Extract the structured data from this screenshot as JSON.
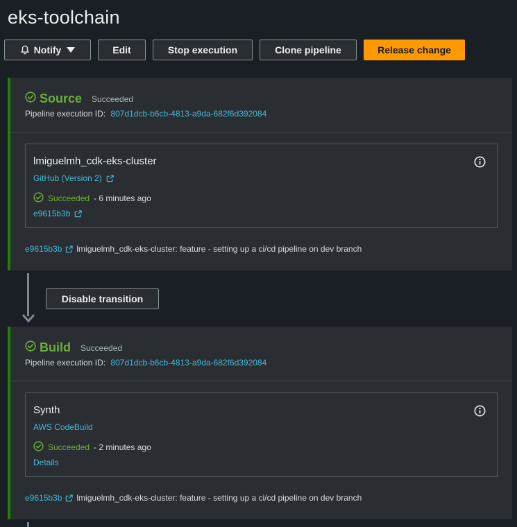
{
  "header": {
    "title": "eks-toolchain"
  },
  "toolbar": {
    "notify_label": "Notify",
    "edit_label": "Edit",
    "stop_label": "Stop execution",
    "clone_label": "Clone pipeline",
    "release_label": "Release change"
  },
  "colors": {
    "accent": "#ff9900",
    "success": "#6aaf35",
    "link": "#44b9d6",
    "stage_border": "#1d8102"
  },
  "stages": [
    {
      "name": "Source",
      "status": "Succeeded",
      "exec_label": "Pipeline execution ID:",
      "exec_id": "807d1dcb-b6cb-4813-a9da-682f6d392084",
      "action": {
        "name": "lmiguelmh_cdk-eks-cluster",
        "provider": "GitHub (Version 2)",
        "status": "Succeeded",
        "time": "- 6 minutes ago",
        "sub_link": "e9615b3b"
      },
      "revision": {
        "id": "e9615b3b",
        "message": "lmiguelmh_cdk-eks-cluster: feature - setting up a ci/cd pipeline on dev branch"
      }
    },
    {
      "name": "Build",
      "status": "Succeeded",
      "exec_label": "Pipeline execution ID:",
      "exec_id": "807d1dcb-b6cb-4813-a9da-682f6d392084",
      "action": {
        "name": "Synth",
        "provider": "AWS CodeBuild",
        "status": "Succeeded",
        "time": "- 2 minutes ago",
        "sub_link": "Details"
      },
      "revision": {
        "id": "e9615b3b",
        "message": "lmiguelmh_cdk-eks-cluster: feature - setting up a ci/cd pipeline on dev branch"
      }
    }
  ],
  "transition": {
    "button_label": "Disable transition"
  },
  "icons": {
    "notify": "bell-icon",
    "caret": "caret-down-icon",
    "success": "check-circle-icon",
    "info": "info-icon",
    "external": "external-link-icon"
  }
}
